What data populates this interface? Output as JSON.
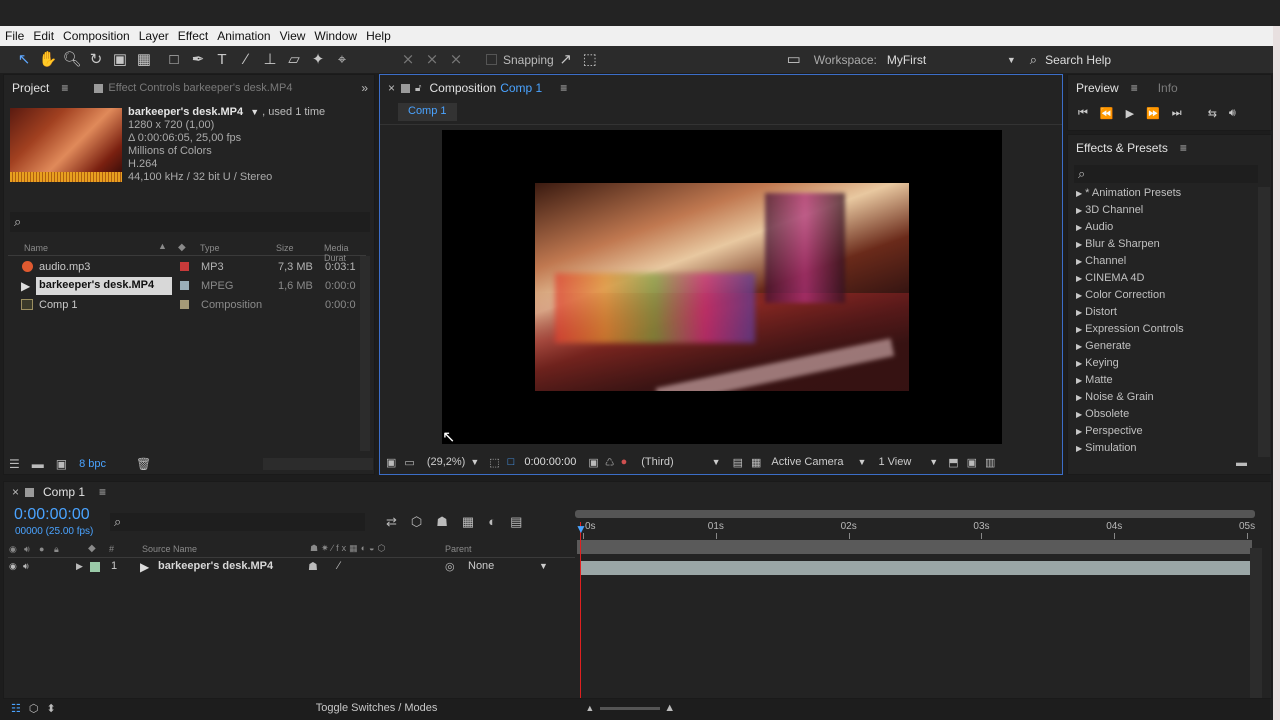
{
  "menubar": [
    "File",
    "Edit",
    "Composition",
    "Layer",
    "Effect",
    "Animation",
    "View",
    "Window",
    "Help"
  ],
  "toolbar": {
    "snapping_label": "Snapping",
    "workspace_label": "Workspace:",
    "workspace_value": "MyFirst",
    "search_label": "Search Help"
  },
  "project": {
    "tab_label": "Project",
    "effect_controls_label": "Effect Controls barkeeper's desk.MP4",
    "footage_name": "barkeeper's desk.MP4",
    "footage_used": ", used 1 time",
    "info_lines": [
      "1280 x 720 (1,00)",
      "Δ 0:00:06:05, 25,00 fps",
      "Millions of Colors",
      "H.264",
      "44,100 kHz / 32 bit U / Stereo"
    ],
    "columns": {
      "name": "Name",
      "type": "Type",
      "size": "Size",
      "media_duration": "Media Durat"
    },
    "items": [
      {
        "name": "audio.mp3",
        "type": "MP3",
        "size": "7,3 MB",
        "duration": "0:03:1"
      },
      {
        "name": "barkeeper's desk.MP4",
        "type": "MPEG",
        "size": "1,6 MB",
        "duration": "0:00:0"
      },
      {
        "name": "Comp 1",
        "type": "Composition",
        "size": "",
        "duration": "0:00:0"
      }
    ],
    "bpc": "8 bpc"
  },
  "composition": {
    "panel_label": "Composition",
    "comp_name": "Comp 1",
    "tab_label": "Comp 1",
    "zoom": "(29,2%)",
    "timecode": "0:00:00:00",
    "resolution": "(Third)",
    "camera": "Active Camera",
    "views": "1 View"
  },
  "preview": {
    "tab_label": "Preview",
    "info_label": "Info"
  },
  "effects": {
    "tab_label": "Effects & Presets",
    "items": [
      "* Animation Presets",
      "3D Channel",
      "Audio",
      "Blur & Sharpen",
      "Channel",
      "CINEMA 4D",
      "Color Correction",
      "Distort",
      "Expression Controls",
      "Generate",
      "Keying",
      "Matte",
      "Noise & Grain",
      "Obsolete",
      "Perspective",
      "Simulation"
    ]
  },
  "timeline": {
    "tab_label": "Comp 1",
    "timecode": "0:00:00:00",
    "frames": "00000 (25.00 fps)",
    "source_name_header": "Source Name",
    "parent_header": "Parent",
    "ruler": [
      "0s",
      "01s",
      "02s",
      "03s",
      "04s",
      "05s"
    ],
    "layer": {
      "index": "1",
      "name": "barkeeper's desk.MP4",
      "parent": "None"
    },
    "toggle_label": "Toggle Switches / Modes"
  }
}
